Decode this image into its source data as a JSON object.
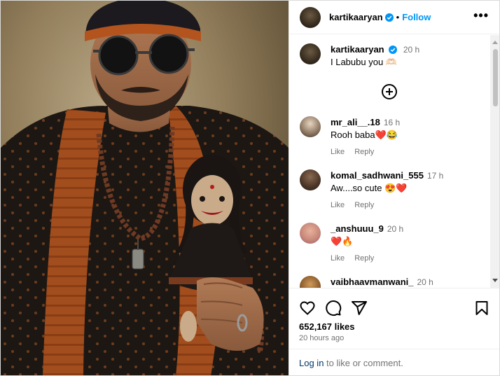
{
  "post": {
    "username": "kartikaaryan",
    "follow_label": "Follow",
    "more_icon": "•••"
  },
  "caption": {
    "username": "kartikaaryan",
    "time": "20 h",
    "text": "I Labubu you 🫶🏻"
  },
  "comments": [
    {
      "username": "mr_ali__.18",
      "time": "16 h",
      "text": "Rooh baba❤️😂",
      "like_label": "Like",
      "reply_label": "Reply"
    },
    {
      "username": "komal_sadhwani_555",
      "time": "17 h",
      "text": "Aw....so cute 😍❤️",
      "like_label": "Like",
      "reply_label": "Reply"
    },
    {
      "username": "_anshuuu_9",
      "time": "20 h",
      "text": "❤️🔥",
      "like_label": "Like",
      "reply_label": "Reply"
    },
    {
      "username": "vaibhaavmanwani_",
      "time": "20 h",
      "text": "",
      "like_label": "",
      "reply_label": ""
    }
  ],
  "footer": {
    "likes": "652,167 likes",
    "ago": "20 hours ago",
    "login_link": "Log in",
    "login_rest": " to like or comment."
  },
  "icons": {
    "like": "heart-icon",
    "comment": "comment-icon",
    "share": "share-icon",
    "save": "bookmark-icon",
    "add": "plus-circle-icon",
    "verified": "verified-badge-icon"
  },
  "colors": {
    "accent": "#0095f6",
    "verified": "#0095f6",
    "muted": "#737373",
    "link": "#00376b"
  }
}
